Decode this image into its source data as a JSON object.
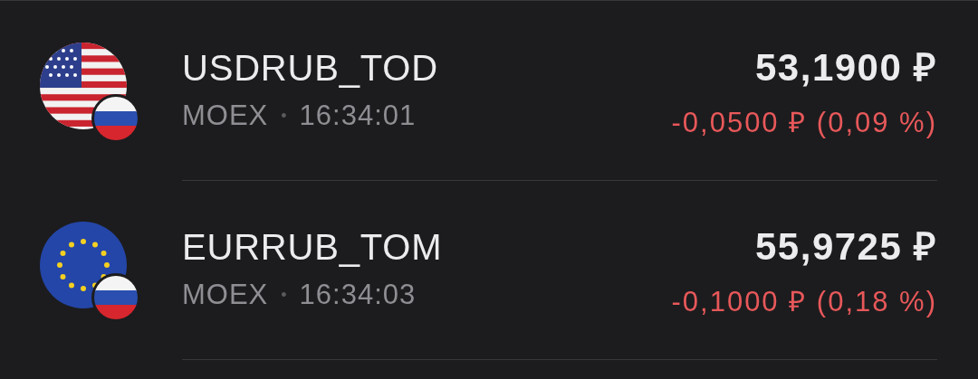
{
  "quotes": [
    {
      "kind": "us",
      "ticker": "USDRUB_TOD",
      "exchange": "MOEX",
      "separator": "•",
      "time": "16:34:01",
      "price": "53,1900 ₽",
      "change": "-0,0500 ₽ (0,09 %)",
      "negative": true
    },
    {
      "kind": "eu",
      "ticker": "EURRUB_TOM",
      "exchange": "MOEX",
      "separator": "•",
      "time": "16:34:03",
      "price": "55,9725 ₽",
      "change": "-0,1000 ₽ (0,18 %)",
      "negative": true
    }
  ]
}
